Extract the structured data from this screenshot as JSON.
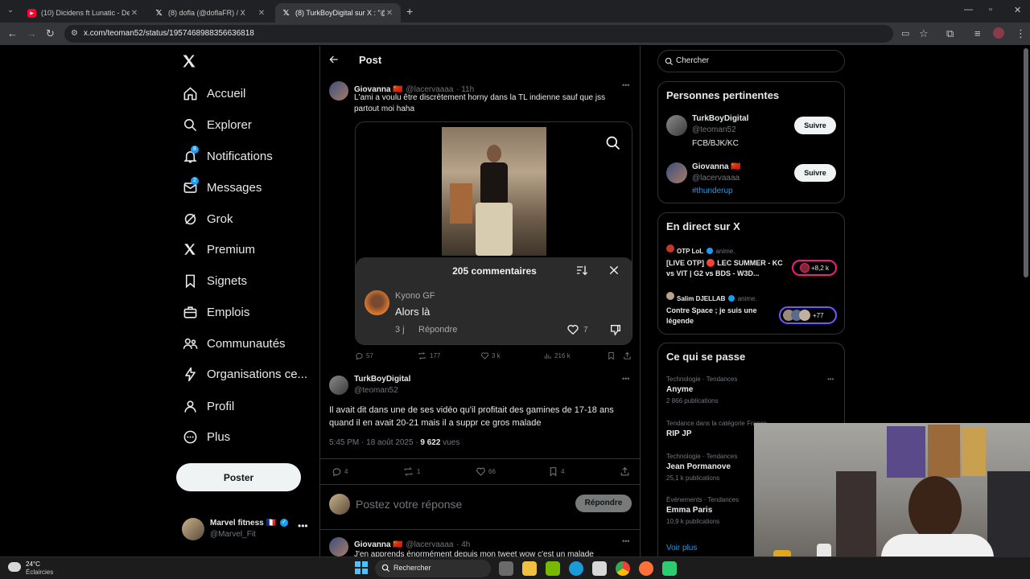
{
  "browser": {
    "tabs": [
      {
        "title": "(10) Dicidens ft Lunatic - De la",
        "icon": "youtube-icon"
      },
      {
        "title": "(8) dofla (@doflaFR) / X",
        "icon": "x-logo-icon"
      },
      {
        "title": "(8) TurkBoyDigital sur X : \"@la",
        "icon": "x-logo-icon"
      }
    ],
    "url": "x.com/teoman52/status/1957468988356636818"
  },
  "nav": {
    "items": [
      {
        "label": "Accueil",
        "icon": "home-icon"
      },
      {
        "label": "Explorer",
        "icon": "search-icon"
      },
      {
        "label": "Notifications",
        "icon": "bell-icon",
        "badge": "8"
      },
      {
        "label": "Messages",
        "icon": "mail-icon",
        "badge": "2"
      },
      {
        "label": "Grok",
        "icon": "grok-icon"
      },
      {
        "label": "Premium",
        "icon": "x-logo-icon"
      },
      {
        "label": "Signets",
        "icon": "bookmark-icon"
      },
      {
        "label": "Emplois",
        "icon": "briefcase-icon"
      },
      {
        "label": "Communautés",
        "icon": "people-icon"
      },
      {
        "label": "Organisations ce...",
        "icon": "lightning-icon"
      },
      {
        "label": "Profil",
        "icon": "person-icon"
      },
      {
        "label": "Plus",
        "icon": "more-circle-icon"
      }
    ],
    "post_button": "Poster",
    "account": {
      "name": "Marvel fitness 🇫🇷",
      "handle": "@Marvel_Fit"
    }
  },
  "header": {
    "title": "Post"
  },
  "quoted_post": {
    "name": "Giovanna 🇨🇳",
    "handle": "@lacervaaaa",
    "time": "· 11h",
    "text": "L'ami a voulu être discrètement horny dans la TL indienne sauf que jss partout moi haha",
    "comments_panel": {
      "title": "205 commentaires",
      "commenter": "Kyono GF",
      "comment": "Alors là",
      "age": "3 j",
      "reply": "Répondre",
      "likes": "7"
    },
    "stats": {
      "replies": "57",
      "reposts": "177",
      "likes": "3 k",
      "views": "216 k"
    }
  },
  "main_post": {
    "name": "TurkBoyDigital",
    "handle": "@teoman52",
    "text": "Il avait dit dans une de ses vidéo qu'il profitait des gamines de 17-18 ans quand il en avait 20-21 mais il a suppr ce gros malade",
    "timestamp": "5:45 PM · 18 août 2025 · ",
    "views_count": "9 622",
    "views_label": " vues",
    "stats": {
      "replies": "4",
      "reposts": "1",
      "likes": "66",
      "bookmarks": "4"
    }
  },
  "reply_box": {
    "placeholder": "Postez votre réponse",
    "button": "Répondre"
  },
  "next_reply": {
    "name": "Giovanna 🇨🇳",
    "handle": "@lacervaaaa",
    "time": "· 4h",
    "text": "J'en apprends énormément depuis mon tweet wow c'est un malade"
  },
  "search": {
    "placeholder": "Chercher"
  },
  "relevant": {
    "title": "Personnes pertinentes",
    "people": [
      {
        "name": "TurkBoyDigital",
        "handle": "@teoman52",
        "bio": "FCB/BJK/KC",
        "button": "Suivre"
      },
      {
        "name": "Giovanna 🇨🇳",
        "handle": "@lacervaaaa",
        "bio": "#thunderup",
        "button": "Suivre"
      }
    ]
  },
  "live": {
    "title": "En direct sur X",
    "items": [
      {
        "host": "OTP LoL",
        "suffix": "anime.",
        "title": "[LIVE OTP] 🔴 LEC SUMMER - KC vs VIT | G2 vs BDS - W3D...",
        "count": "+8,2 k"
      },
      {
        "host": "Salim DJELLAB",
        "suffix": "anime.",
        "title": "Contre Space ; je suis une légende",
        "count": "+77"
      }
    ]
  },
  "trends": {
    "title": "Ce qui se passe",
    "items": [
      {
        "category": "Technologie · Tendances",
        "name": "Anyme",
        "count": "2 866 publications"
      },
      {
        "category": "Tendance dans la catégorie France",
        "name": "RIP JP",
        "count": ""
      },
      {
        "category": "Technologie · Tendances",
        "name": "Jean Pormanove",
        "count": "25,1 k publications"
      },
      {
        "category": "Événements · Tendances",
        "name": "Emma Paris",
        "count": "10,9 k publications"
      }
    ],
    "more": "Voir plus"
  },
  "taskbar": {
    "weather_temp": "24°C",
    "weather_desc": "Éclaircies",
    "search_placeholder": "Rechercher"
  },
  "colors": {
    "accent": "#1d9bf0",
    "background": "#000000",
    "border": "#2f3336",
    "muted": "#71767b"
  }
}
